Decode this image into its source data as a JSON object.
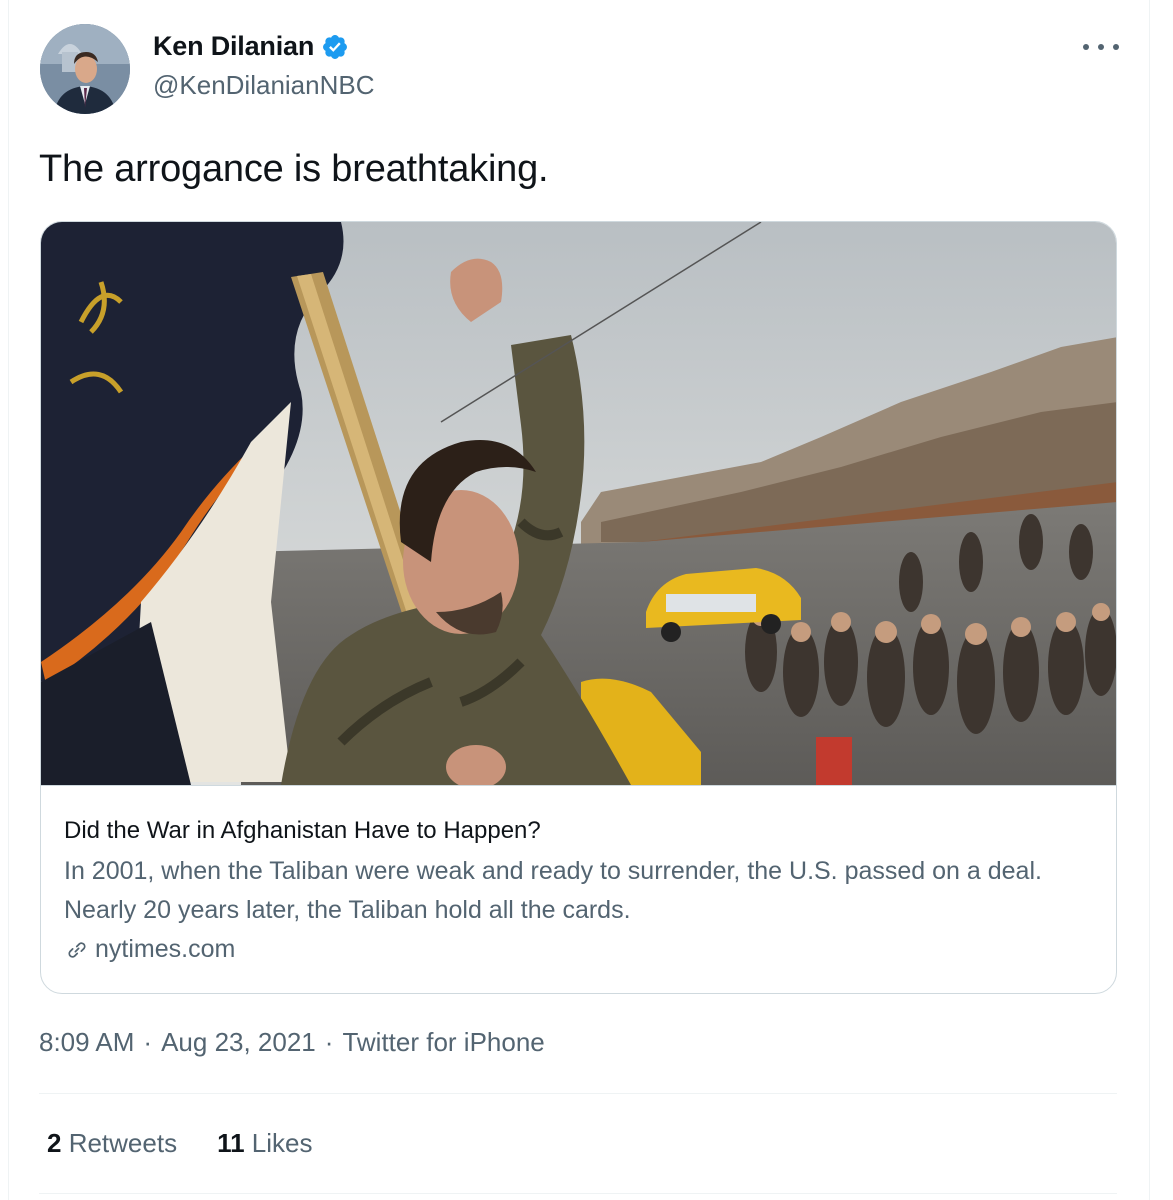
{
  "author": {
    "display_name": "Ken Dilanian",
    "handle": "@KenDilanianNBC",
    "verified_icon": "verified-badge-icon",
    "avatar_icon": "profile-photo"
  },
  "tweet": {
    "text": "The arrogance is breathtaking."
  },
  "card": {
    "image": "news-photo-kabul-street-protest",
    "title": "Did the War in Afghanistan Have to Happen?",
    "description": "In 2001, when the Taliban were weak and ready to surrender, the U.S. passed on a deal. Nearly 20 years later, the Taliban hold all the cards.",
    "domain": "nytimes.com",
    "link_icon": "link-icon"
  },
  "meta": {
    "time": "8:09 AM",
    "separator": "·",
    "date": "Aug 23, 2021",
    "source": "Twitter for iPhone"
  },
  "stats": [
    {
      "count": "2",
      "label": "Retweets"
    },
    {
      "count": "11",
      "label": "Likes"
    }
  ],
  "colors": {
    "text_primary": "#0f1419",
    "text_secondary": "#536471",
    "verified_blue": "#1d9bf0",
    "border": "#cfd9de"
  }
}
